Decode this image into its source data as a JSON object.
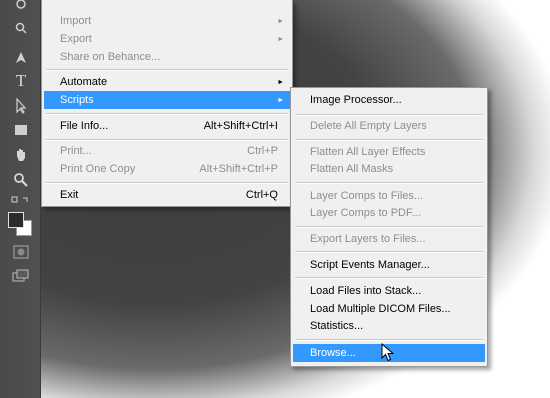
{
  "file_menu": {
    "items": [
      {
        "label": "Import",
        "shortcut": "",
        "submenu": true,
        "state": "disabled"
      },
      {
        "label": "Export",
        "shortcut": "",
        "submenu": true,
        "state": "disabled"
      },
      {
        "label": "Share on Behance...",
        "shortcut": "",
        "submenu": false,
        "state": "disabled"
      },
      {
        "label": "Automate",
        "shortcut": "",
        "submenu": true,
        "state": "normal"
      },
      {
        "label": "Scripts",
        "shortcut": "",
        "submenu": true,
        "state": "highlighted"
      },
      {
        "label": "File Info...",
        "shortcut": "Alt+Shift+Ctrl+I",
        "submenu": false,
        "state": "normal"
      },
      {
        "label": "Print...",
        "shortcut": "Ctrl+P",
        "submenu": false,
        "state": "disabled"
      },
      {
        "label": "Print One Copy",
        "shortcut": "Alt+Shift+Ctrl+P",
        "submenu": false,
        "state": "disabled"
      },
      {
        "label": "Exit",
        "shortcut": "Ctrl+Q",
        "submenu": false,
        "state": "normal"
      }
    ],
    "arrow_glyph": "►"
  },
  "scripts_menu": {
    "items": [
      {
        "label": "Image Processor...",
        "state": "normal"
      },
      {
        "label": "Delete All Empty Layers",
        "state": "disabled"
      },
      {
        "label": "Flatten All Layer Effects",
        "state": "disabled"
      },
      {
        "label": "Flatten All Masks",
        "state": "disabled"
      },
      {
        "label": "Layer Comps to Files...",
        "state": "disabled"
      },
      {
        "label": "Layer Comps to PDF...",
        "state": "disabled"
      },
      {
        "label": "Export Layers to Files...",
        "state": "disabled"
      },
      {
        "label": "Script Events Manager...",
        "state": "normal"
      },
      {
        "label": "Load Files into Stack...",
        "state": "normal"
      },
      {
        "label": "Load Multiple DICOM Files...",
        "state": "normal"
      },
      {
        "label": "Statistics...",
        "state": "normal"
      },
      {
        "label": "Browse...",
        "state": "highlighted"
      }
    ]
  },
  "toolbar": {
    "tools": [
      "pen-icon",
      "type-icon",
      "path-selection-icon",
      "rectangle-icon",
      "hand-icon",
      "zoom-icon",
      "more-tools-icon",
      "quick-mask-icon",
      "screen-mode-icon"
    ],
    "type_glyph": "T"
  },
  "colors": {
    "highlight": "#3399ff",
    "menu_bg": "#f0f0f0",
    "disabled_text": "#8e8e8e",
    "workspace": "#434343"
  }
}
